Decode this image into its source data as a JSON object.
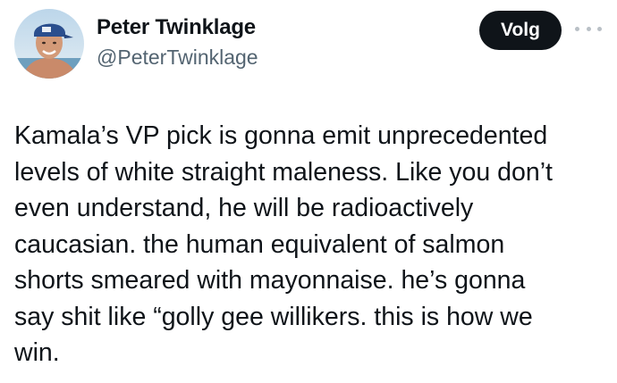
{
  "author": {
    "display_name": "Peter Twinklage",
    "handle": "@PeterTwinklage",
    "avatar_icon": "profile-photo"
  },
  "actions": {
    "follow_label": "Volg",
    "more_icon": "more-dots-icon"
  },
  "tweet": {
    "lines": [
      "Kamala’s VP pick is gonna emit unprecedented",
      "levels of white straight maleness. Like you don’t",
      "even understand, he will be radioactively",
      "caucasian. the human equivalent of salmon",
      "shorts smeared with mayonnaise. he’s gonna",
      "say shit like “golly gee willikers. this is how we",
      "win."
    ]
  },
  "colors": {
    "text": "#0f1419",
    "secondary_text": "#536471",
    "button_bg": "#0f1419",
    "button_text": "#ffffff"
  }
}
